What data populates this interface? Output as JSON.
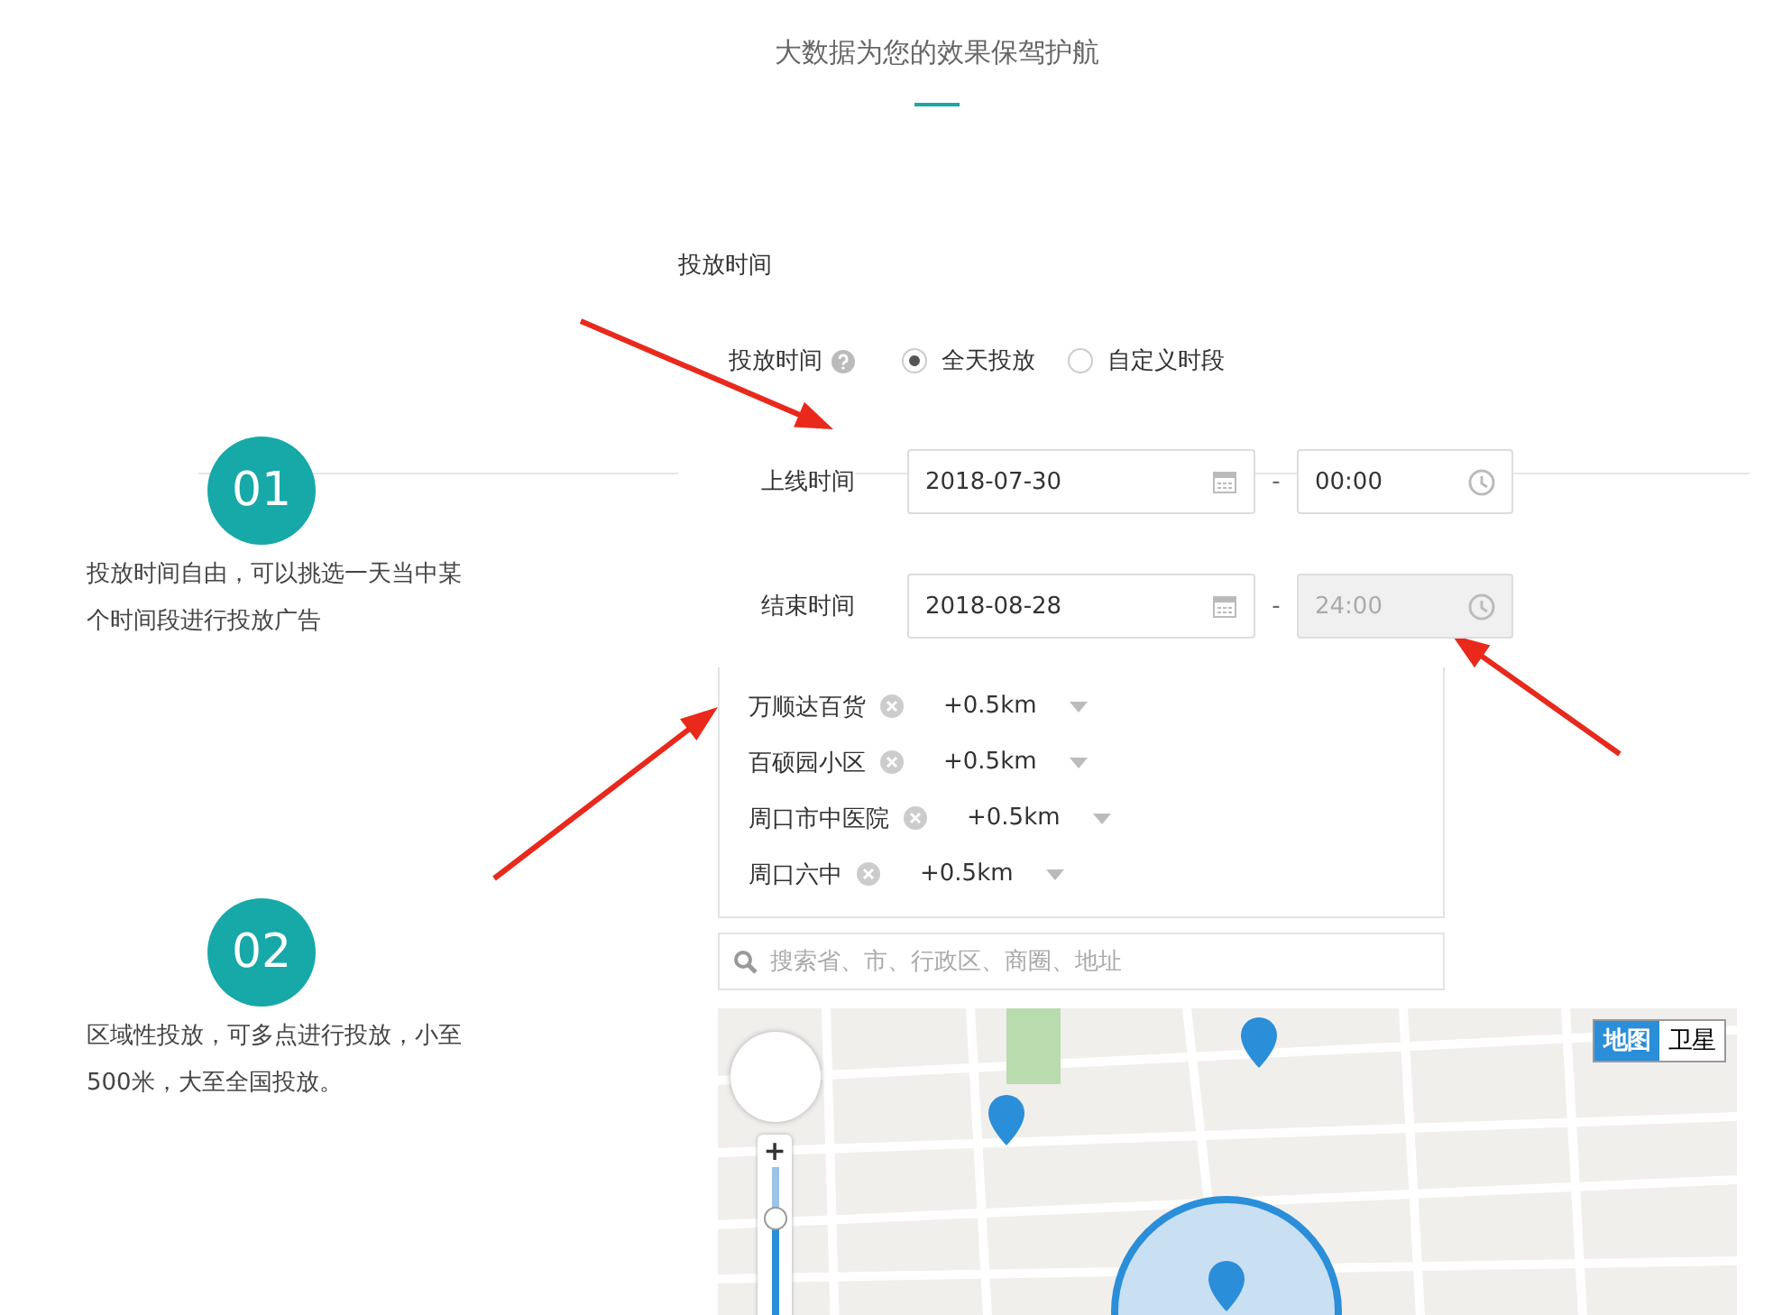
{
  "header": {
    "subtitle": "大数据为您的效果保驾护航"
  },
  "features": [
    {
      "number": "01",
      "text": "投放时间自由，可以挑选一天当中某个时间段进行投放广告"
    },
    {
      "number": "02",
      "text": "区域性投放，可多点进行投放，小至500米，大至全国投放。"
    }
  ],
  "schedule": {
    "section_title": "投放时间",
    "mode_label": "投放时间",
    "modes": [
      {
        "label": "全天投放",
        "selected": true
      },
      {
        "label": "自定义时段",
        "selected": false
      }
    ],
    "rows": [
      {
        "label": "上线时间",
        "date": "2018-07-30",
        "separator": "-",
        "time": "00:00",
        "time_disabled": false
      },
      {
        "label": "结束时间",
        "date": "2018-08-28",
        "separator": "-",
        "time": "24:00",
        "time_disabled": true
      }
    ]
  },
  "locations": {
    "items": [
      {
        "name": "万顺达百货",
        "radius": "+0.5km"
      },
      {
        "name": "百硕园小区",
        "radius": "+0.5km"
      },
      {
        "name": "周口市中医院",
        "radius": "+0.5km"
      },
      {
        "name": "周口六中",
        "radius": "+0.5km"
      }
    ],
    "search": {
      "placeholder": "搜索省、市、行政区、商圈、地址"
    }
  },
  "map": {
    "types": [
      {
        "label": "地图",
        "selected": true
      },
      {
        "label": "卫星",
        "selected": false
      }
    ],
    "zoom_in": "+",
    "zoom": {
      "level": 0.75
    }
  }
}
